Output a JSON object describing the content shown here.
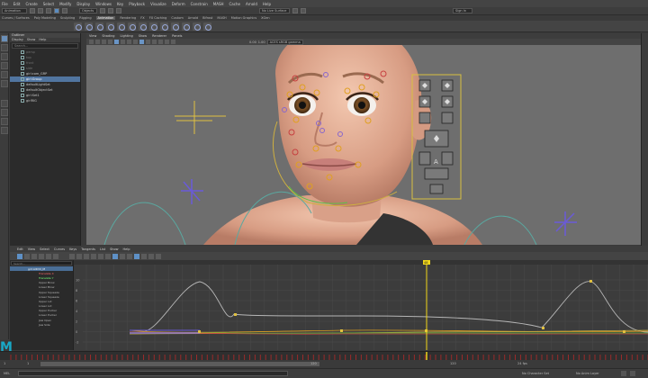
{
  "menubar": {
    "items": [
      "File",
      "Edit",
      "Create",
      "Select",
      "Modify",
      "Display",
      "Windows",
      "Key",
      "Playback",
      "Visualize",
      "Deform",
      "Constrain",
      "MASH",
      "Cache",
      "Arnold",
      "Help"
    ]
  },
  "statusline": {
    "mode": "Animation",
    "objects_field": "Objects",
    "no_live": "No Live Surface",
    "signin": "Sign In"
  },
  "shelf": {
    "tabs": [
      "Curves / Surfaces",
      "Poly Modeling",
      "Sculpting",
      "Rigging",
      "Animation",
      "Rendering",
      "FX",
      "FX Caching",
      "Custom",
      "Arnold",
      "Bifrost",
      "MASH",
      "Motion Graphics",
      "XGen"
    ],
    "active_tab": "Animation"
  },
  "outliner": {
    "title": "Outliner",
    "menu": [
      "Display",
      "Show",
      "Help"
    ],
    "search_placeholder": "Search...",
    "items": [
      {
        "label": "persp",
        "dim": true
      },
      {
        "label": "top",
        "dim": true
      },
      {
        "label": "front",
        "dim": true
      },
      {
        "label": "side",
        "dim": true
      },
      {
        "label": "girl:com_GRP",
        "dim": false
      },
      {
        "label": "girl:Group",
        "dim": false,
        "selected": true
      },
      {
        "label": "defaultLightSet",
        "dim": false
      },
      {
        "label": "defaultObjectSet",
        "dim": false
      },
      {
        "label": "girl:Set1",
        "dim": false
      },
      {
        "label": "girlRIG",
        "dim": false
      }
    ]
  },
  "viewport": {
    "menu": [
      "View",
      "Shading",
      "Lighting",
      "Show",
      "Renderer",
      "Panels"
    ],
    "camera_field": "ACES sRGB gamma",
    "gamma_value": "0.00",
    "gain_value": "1.00"
  },
  "graph_editor": {
    "menu": [
      "Edit",
      "View",
      "Select",
      "Curves",
      "Keys",
      "Tangents",
      "List",
      "Show",
      "Help"
    ],
    "search_placeholder": "Search...",
    "header_item": "girl:AllCtrl_M",
    "channels": [
      {
        "label": "Translate X",
        "color": "red"
      },
      {
        "label": "Translate Y",
        "color": "green"
      },
      {
        "label": "Upper Brow",
        "color": ""
      },
      {
        "label": "Lower Brow",
        "color": ""
      },
      {
        "label": "Upper Squeeze",
        "color": ""
      },
      {
        "label": "Lower Squeeze",
        "color": ""
      },
      {
        "label": "Upper Lid",
        "color": ""
      },
      {
        "label": "Lower Lid",
        "color": ""
      },
      {
        "label": "Upper Pucker",
        "color": ""
      },
      {
        "label": "Lower Pucker",
        "color": ""
      },
      {
        "label": "Jaw Open",
        "color": ""
      },
      {
        "label": "Jaw Side",
        "color": ""
      }
    ],
    "y_ticks": [
      "10",
      "8",
      "6",
      "4",
      "2",
      "0",
      "-2"
    ],
    "current_frame": "48"
  },
  "timeslider": {
    "start": "1",
    "end": "120",
    "range_start": "1",
    "range_end": "120",
    "fps": "24 fps"
  },
  "cmdline": {
    "label": "MEL",
    "char_set": "No Character Set",
    "anim_layer": "No Anim Layer"
  },
  "colors": {
    "selection_blue": "#5175a0",
    "timeline_yellow": "#f2d71a",
    "curve_gray": "#b6b6b6",
    "logo_cyan": "#19a8c6"
  }
}
